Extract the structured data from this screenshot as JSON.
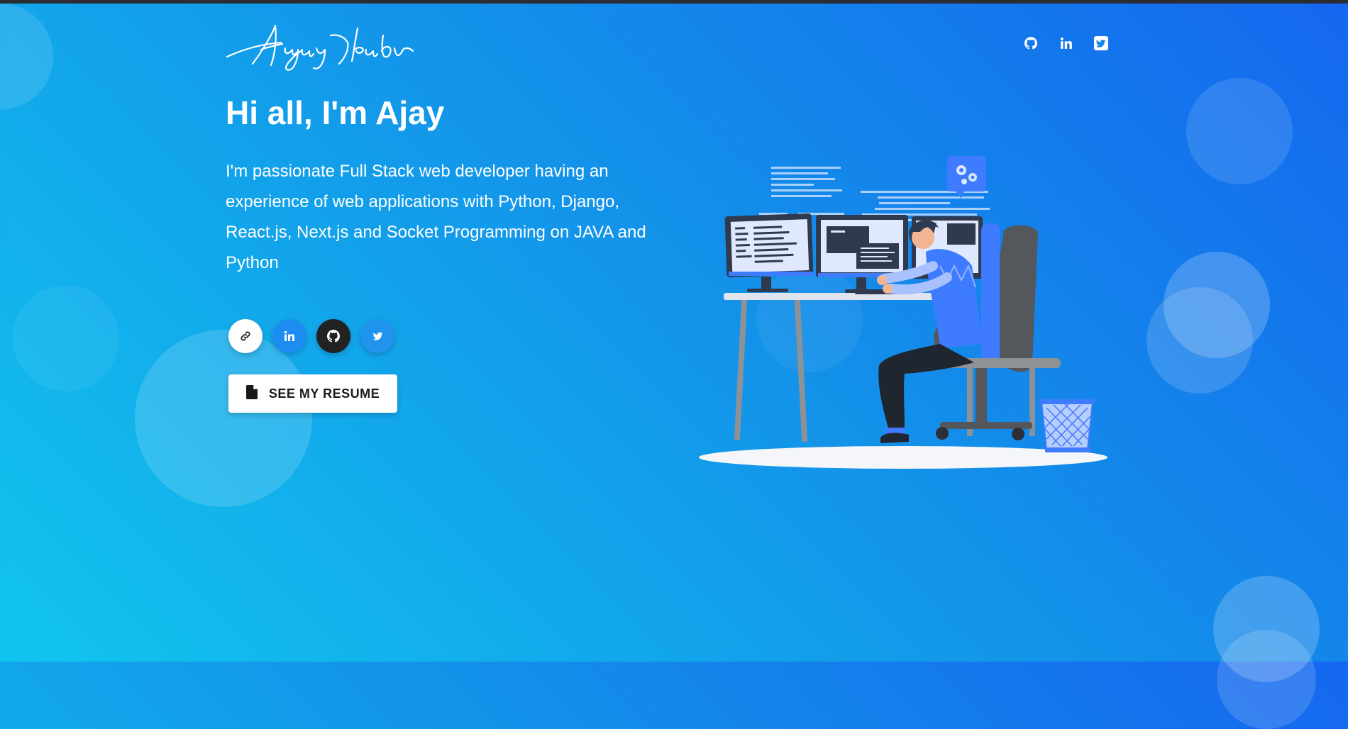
{
  "brand": {
    "logo_text": "Ajay Yadav"
  },
  "nav": {
    "icons": [
      "github-icon",
      "linkedin-icon",
      "twitter-square-icon"
    ]
  },
  "hero": {
    "greeting": "Hi all, I'm Ajay",
    "intro": "I'm passionate Full Stack web developer having an experience of web applications with Python, Django, React.js, Next.js and Socket Programming on JAVA and Python",
    "socials": [
      "link-icon",
      "linkedin-icon",
      "github-icon",
      "twitter-icon"
    ],
    "resume_label": "SEE MY RESUME"
  },
  "colors": {
    "gradient_start": "#1567ef",
    "gradient_end": "#11c5ee",
    "accent_blue": "#2f6bff",
    "chair_gray": "#54575c"
  }
}
